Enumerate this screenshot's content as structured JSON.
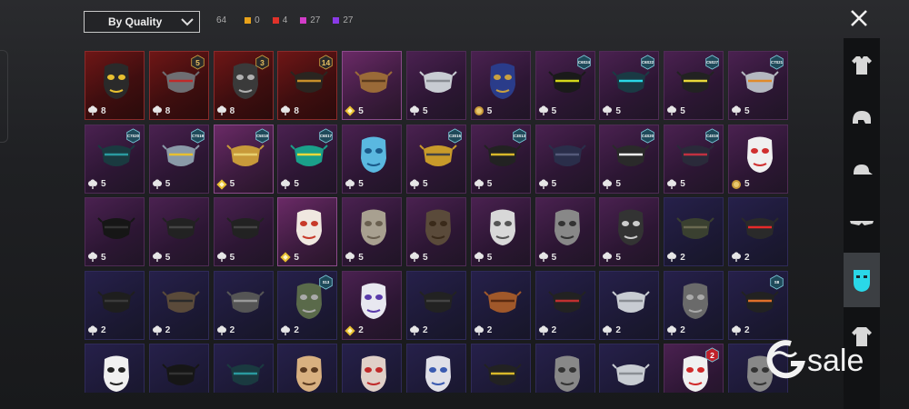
{
  "filter": {
    "label": "By Quality"
  },
  "counts": {
    "total": "64",
    "items": [
      {
        "value": "0",
        "color": "#e8a21a"
      },
      {
        "value": "4",
        "color": "#e0322a"
      },
      {
        "value": "27",
        "color": "#d23cc8"
      },
      {
        "value": "27",
        "color": "#8a3ae6"
      }
    ]
  },
  "categories": [
    {
      "icon": "outfit-icon",
      "active": false
    },
    {
      "icon": "helmet-icon",
      "active": false
    },
    {
      "icon": "cap-icon",
      "active": false
    },
    {
      "icon": "glasses-icon",
      "active": false
    },
    {
      "icon": "mask-icon",
      "active": true
    },
    {
      "icon": "jacket-icon",
      "active": false
    }
  ],
  "rows": [
    [
      {
        "q": "red",
        "cur": "mist",
        "n": "8",
        "badge": "",
        "mask": "robot"
      },
      {
        "q": "red",
        "cur": "mist",
        "n": "8",
        "badge": "5",
        "mask": "gas"
      },
      {
        "q": "red",
        "cur": "mist",
        "n": "8",
        "badge": "3",
        "mask": "wolf"
      },
      {
        "q": "red",
        "cur": "mist",
        "n": "8",
        "badge": "14",
        "mask": "half"
      },
      {
        "q": "orange",
        "cur": "diamond",
        "n": "5",
        "badge": "",
        "mask": "bandana"
      },
      {
        "q": "purple",
        "cur": "mist",
        "n": "5",
        "badge": "",
        "mask": "surgical"
      },
      {
        "q": "purple",
        "cur": "coin",
        "n": "5",
        "badge": "",
        "mask": "dragon"
      },
      {
        "q": "purple",
        "cur": "mist",
        "n": "5",
        "badge": "C6S24",
        "mask": "slit"
      },
      {
        "q": "purple",
        "cur": "mist",
        "n": "5",
        "badge": "C6S22",
        "mask": "cyber"
      },
      {
        "q": "purple",
        "cur": "mist",
        "n": "5",
        "badge": "C5S27",
        "mask": "ring"
      },
      {
        "q": "purple",
        "cur": "mist",
        "n": "5",
        "badge": "C7S21",
        "mask": "silver"
      }
    ],
    [
      {
        "q": "purple",
        "cur": "mist",
        "n": "5",
        "badge": "C7S20",
        "mask": "teal"
      },
      {
        "q": "purple",
        "cur": "mist",
        "n": "5",
        "badge": "C7S19",
        "mask": "blue"
      },
      {
        "q": "orange",
        "cur": "diamond",
        "n": "5",
        "badge": "C5S18",
        "mask": "gold"
      },
      {
        "q": "purple",
        "cur": "mist",
        "n": "5",
        "badge": "C6S17",
        "mask": "green"
      },
      {
        "q": "purple",
        "cur": "mist",
        "n": "5",
        "badge": "",
        "mask": "oni"
      },
      {
        "q": "purple",
        "cur": "mist",
        "n": "5",
        "badge": "C3S15",
        "mask": "yellow"
      },
      {
        "q": "purple",
        "cur": "mist",
        "n": "5",
        "badge": "C3S13",
        "mask": "yellowblack"
      },
      {
        "q": "purple",
        "cur": "mist",
        "n": "5",
        "badge": "",
        "mask": "navy"
      },
      {
        "q": "purple",
        "cur": "mist",
        "n": "5",
        "badge": "C4S20",
        "mask": "teeth"
      },
      {
        "q": "purple",
        "cur": "mist",
        "n": "5",
        "badge": "C4S19",
        "mask": "redeye"
      },
      {
        "q": "purple",
        "cur": "coin",
        "n": "5",
        "badge": "",
        "mask": "kitsune"
      }
    ],
    [
      {
        "q": "purple",
        "cur": "mist",
        "n": "5",
        "badge": "",
        "mask": "black"
      },
      {
        "q": "purple",
        "cur": "mist",
        "n": "5",
        "badge": "",
        "mask": "dark"
      },
      {
        "q": "purple",
        "cur": "mist",
        "n": "5",
        "badge": "",
        "mask": "dark"
      },
      {
        "q": "orange",
        "cur": "diamond",
        "n": "5",
        "badge": "",
        "mask": "joker"
      },
      {
        "q": "purple",
        "cur": "mist",
        "n": "5",
        "badge": "",
        "mask": "gas2"
      },
      {
        "q": "purple",
        "cur": "mist",
        "n": "5",
        "badge": "",
        "mask": "plague"
      },
      {
        "q": "purple",
        "cur": "mist",
        "n": "5",
        "badge": "",
        "mask": "hockey"
      },
      {
        "q": "purple",
        "cur": "mist",
        "n": "5",
        "badge": "",
        "mask": "skull"
      },
      {
        "q": "purple",
        "cur": "mist",
        "n": "5",
        "badge": "",
        "mask": "wrap"
      },
      {
        "q": "blue",
        "cur": "mist",
        "n": "2",
        "badge": "",
        "mask": "olive"
      },
      {
        "q": "blue",
        "cur": "mist",
        "n": "2",
        "badge": "",
        "mask": "laser"
      }
    ],
    [
      {
        "q": "blue",
        "cur": "mist",
        "n": "2",
        "badge": "",
        "mask": "strap"
      },
      {
        "q": "blue",
        "cur": "mist",
        "n": "2",
        "badge": "",
        "mask": "cloth"
      },
      {
        "q": "blue",
        "cur": "mist",
        "n": "2",
        "badge": "",
        "mask": "wire"
      },
      {
        "q": "blue",
        "cur": "mist",
        "n": "2",
        "badge": "S13",
        "mask": "gasgreen"
      },
      {
        "q": "purple",
        "cur": "diamond",
        "n": "2",
        "badge": "",
        "mask": "whitepurple"
      },
      {
        "q": "blue",
        "cur": "mist",
        "n": "2",
        "badge": "",
        "mask": "dark"
      },
      {
        "q": "blue",
        "cur": "mist",
        "n": "2",
        "badge": "",
        "mask": "rust"
      },
      {
        "q": "blue",
        "cur": "mist",
        "n": "2",
        "badge": "",
        "mask": "redblack"
      },
      {
        "q": "blue",
        "cur": "mist",
        "n": "2",
        "badge": "",
        "mask": "surgical"
      },
      {
        "q": "blue",
        "cur": "mist",
        "n": "2",
        "badge": "",
        "mask": "bandage"
      },
      {
        "q": "blue",
        "cur": "mist",
        "n": "2",
        "badge": "S8",
        "mask": "flame"
      }
    ],
    [
      {
        "q": "blue",
        "cur": "mist",
        "n": "",
        "badge": "",
        "mask": "sugar"
      },
      {
        "q": "blue",
        "cur": "mist",
        "n": "",
        "badge": "",
        "mask": "black"
      },
      {
        "q": "blue",
        "cur": "mist",
        "n": "",
        "badge": "",
        "mask": "teal"
      },
      {
        "q": "blue",
        "cur": "mist",
        "n": "",
        "badge": "",
        "mask": "jason"
      },
      {
        "q": "blue",
        "cur": "mist",
        "n": "",
        "badge": "",
        "mask": "jasonred"
      },
      {
        "q": "blue",
        "cur": "mist",
        "n": "",
        "badge": "",
        "mask": "jasonblue"
      },
      {
        "q": "blue",
        "cur": "mist",
        "n": "",
        "badge": "",
        "mask": "yellowblack"
      },
      {
        "q": "blue",
        "cur": "mist",
        "n": "",
        "badge": "",
        "mask": "skull"
      },
      {
        "q": "blue",
        "cur": "mist",
        "n": "",
        "badge": "",
        "mask": "surgical"
      },
      {
        "q": "purple",
        "cur": "mist",
        "n": "",
        "badge": "2",
        "mask": "clown"
      },
      {
        "q": "blue",
        "cur": "mist",
        "n": "",
        "badge": "",
        "mask": "skull"
      }
    ]
  ],
  "watermark": {
    "text": "sale"
  },
  "colors": {
    "robot": [
      "#2a2a2a",
      "#e8c030"
    ],
    "gas": [
      "#6e6e72",
      "#c02a2a"
    ],
    "wolf": [
      "#3a3a3a",
      "#b0b0b0"
    ],
    "half": [
      "#2a2520",
      "#c8902a"
    ],
    "bandana": [
      "#9a6a38",
      "#5a3a1c"
    ],
    "surgical": [
      "#c8ccd2",
      "#8a8e94"
    ],
    "dragon": [
      "#2a3c8a",
      "#c8a040"
    ],
    "slit": [
      "#1a1a1a",
      "#d4d81a"
    ],
    "cyber": [
      "#1a3a44",
      "#2ad8e8"
    ],
    "ring": [
      "#222",
      "#e8d83a"
    ],
    "silver": [
      "#b4b8c0",
      "#e08a2a"
    ],
    "teal": [
      "#1a3a40",
      "#2a9aa0"
    ],
    "blue": [
      "#8a9aa8",
      "#e8c030"
    ],
    "gold": [
      "#c89a3a",
      "#e8d070"
    ],
    "green": [
      "#1aa08a",
      "#e8d83a"
    ],
    "oni": [
      "#5ab8e0",
      "#1a5a8a"
    ],
    "yellow": [
      "#c89a2a",
      "#444"
    ],
    "yellowblack": [
      "#222",
      "#d8b82a"
    ],
    "navy": [
      "#2a2e4a",
      "#555a7a"
    ],
    "teeth": [
      "#2a2a2a",
      "#f0f0f0"
    ],
    "redeye": [
      "#2a2a3a",
      "#c03040"
    ],
    "kitsune": [
      "#f0f0f0",
      "#d03030"
    ],
    "black": [
      "#161616",
      "#333"
    ],
    "dark": [
      "#222",
      "#444"
    ],
    "joker": [
      "#f0e8e0",
      "#c83a2a"
    ],
    "gas2": [
      "#a8a090",
      "#6a6050"
    ],
    "plague": [
      "#5a4a3a",
      "#3a2a1a"
    ],
    "hockey": [
      "#d8d8d8",
      "#555"
    ],
    "skull": [
      "#888",
      "#333"
    ],
    "wrap": [
      "#333",
      "#ccc"
    ],
    "olive": [
      "#3a4030",
      "#6a6a50"
    ],
    "laser": [
      "#2a2a2a",
      "#e82a2a"
    ],
    "strap": [
      "#1e1e1e",
      "#3a3a3a"
    ],
    "cloth": [
      "#5a4a3a",
      "#2a2a2a"
    ],
    "wire": [
      "#555",
      "#999"
    ],
    "gasgreen": [
      "#5a6a4a",
      "#aaa"
    ],
    "whitepurple": [
      "#e8e8f0",
      "#5a3aaa"
    ],
    "rust": [
      "#a0582a",
      "#5a2a10"
    ],
    "redblack": [
      "#222",
      "#c03030"
    ],
    "bandage": [
      "#6a6a6a",
      "#aaa"
    ],
    "flame": [
      "#222",
      "#e0702a"
    ],
    "sugar": [
      "#f0f0f0",
      "#222"
    ],
    "jason": [
      "#d8b080",
      "#5a3a20"
    ],
    "jasonred": [
      "#e0d0c8",
      "#c02a2a"
    ],
    "jasonblue": [
      "#e0e0e8",
      "#3a5ab0"
    ],
    "clown": [
      "#f0f0f0",
      "#d02a2a"
    ]
  }
}
